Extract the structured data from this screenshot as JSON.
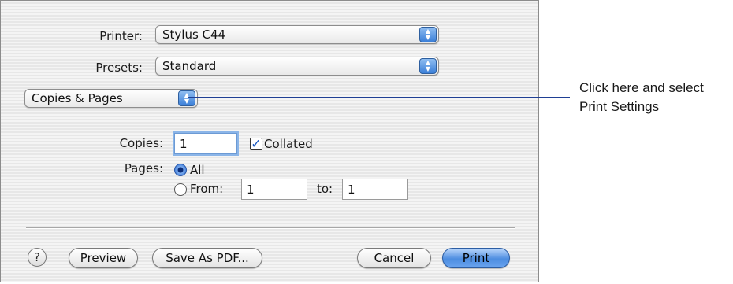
{
  "printer": {
    "label": "Printer:",
    "value": "Stylus C44"
  },
  "presets": {
    "label": "Presets:",
    "value": "Standard"
  },
  "panel_menu": {
    "value": "Copies & Pages"
  },
  "copies": {
    "label": "Copies:",
    "value": "1",
    "collated_label": "Collated",
    "collated_checked": true
  },
  "pages": {
    "label": "Pages:",
    "all_label": "All",
    "from_label": "From:",
    "from_value": "1",
    "to_label": "to:",
    "to_value": "1",
    "selected": "all"
  },
  "buttons": {
    "help": "?",
    "preview": "Preview",
    "save_pdf": "Save As PDF...",
    "cancel": "Cancel",
    "print": "Print"
  },
  "callout": {
    "line1": "Click here and select",
    "line2": "Print Settings"
  },
  "colors": {
    "accent": "#3b7fd8",
    "callout_line": "#1f3f94"
  },
  "icons": {
    "popup_arrows": "up-down-arrows-icon",
    "checkmark": "checkmark-icon"
  }
}
